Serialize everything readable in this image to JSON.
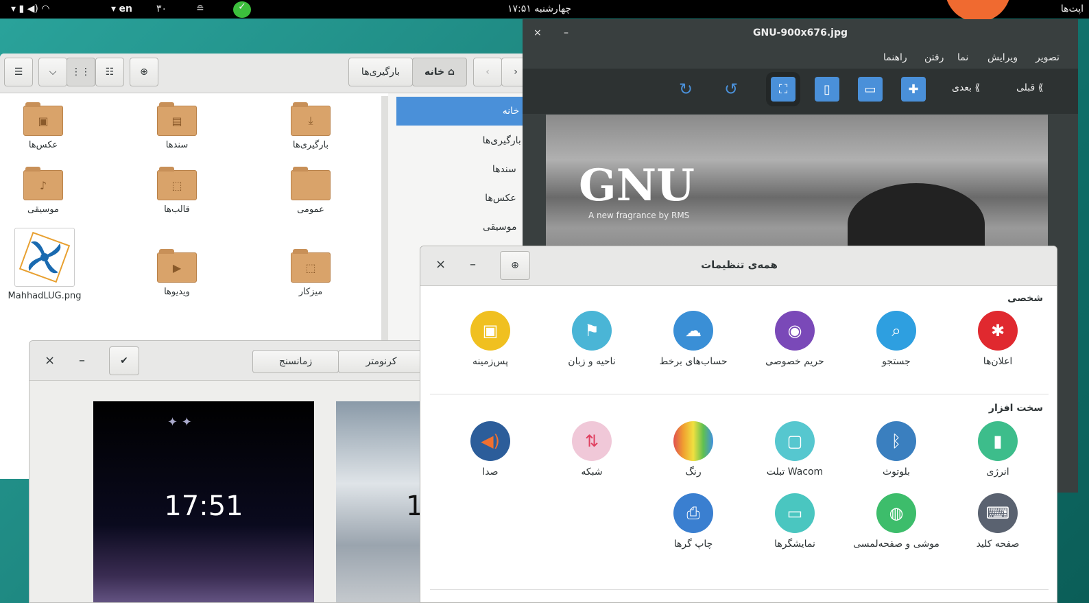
{
  "topbar": {
    "activities": "اپت‌ها",
    "clock": "چهارشنبه ۱۷:۵۱",
    "day": "۳۰",
    "lang": "en"
  },
  "files": {
    "path": [
      "خانه",
      "بارگیری‌ها"
    ],
    "sidebar": [
      "خانه",
      "بارگیری‌ها",
      "سندها",
      "عکس‌ها",
      "موسیقی"
    ],
    "folders": [
      "بارگیری‌ها",
      "سندها",
      "عکس‌ها",
      "عمومی",
      "قالب‌ها",
      "موسیقی",
      "میزکار",
      "ویدیوها",
      "MahhadLUG.png"
    ]
  },
  "viewer": {
    "title": "GNU-900x676.jpg",
    "menu": [
      "تصویر",
      "ویرایش",
      "نما",
      "رفتن",
      "راهنما"
    ],
    "prev": "قبلی",
    "next": "بعدی",
    "image_title": "GNU",
    "image_sub": "A new fragrance by RMS"
  },
  "clocks": {
    "tabs": [
      "کرنومتر",
      "زمانسنج"
    ],
    "time": "17:51",
    "time2": "1"
  },
  "settings": {
    "title": "همه‌ی تنظیمات",
    "personal": "شخصی",
    "hardware": "سخت افزار",
    "personal_items": [
      "اعلان‌ها",
      "جستجو",
      "حریم خصوصی",
      "حساب‌های برخط",
      "ناحیه و زبان",
      "پس‌زمینه"
    ],
    "hardware_items": [
      "انرژی",
      "بلوتوث",
      "تبلت Wacom",
      "رنگ",
      "شبکه",
      "صدا"
    ],
    "hardware_items2": [
      "صفحه کلید",
      "موشی و صفحه‌لمسی",
      "نمایشگرها",
      "چاپ گرها"
    ],
    "colors": {
      "notify": "#e0292f",
      "search": "#2e9fe0",
      "privacy": "#7a49b8",
      "online": "#3a8fd6",
      "region": "#4ab5d6",
      "bg": "#f0c020",
      "power": "#3dbd8b",
      "bt": "#3a7fbf",
      "wacom": "#56c7cf",
      "color": "#e4b040",
      "net": "#e06a90",
      "sound": "#2c5d9a",
      "kbd": "#5a6270",
      "mouse": "#3dbd6b",
      "display": "#4ac6c0",
      "print": "#3a7fd0"
    }
  }
}
